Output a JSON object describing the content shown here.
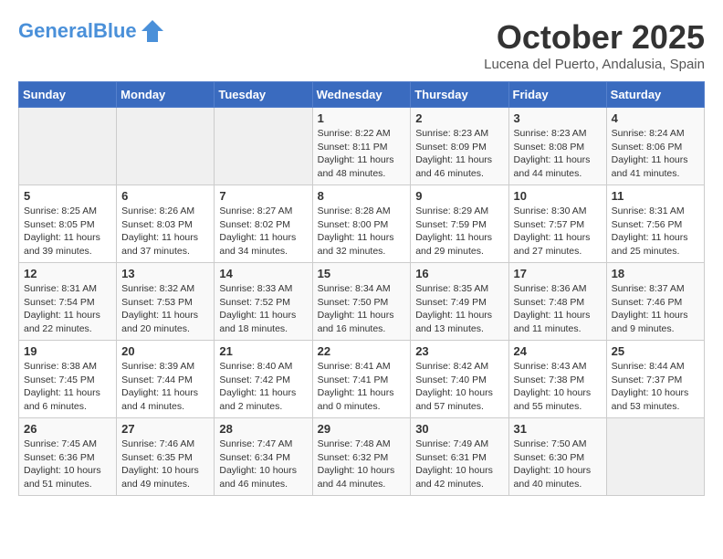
{
  "header": {
    "logo_line1": "General",
    "logo_line2": "Blue",
    "month": "October 2025",
    "location": "Lucena del Puerto, Andalusia, Spain"
  },
  "weekdays": [
    "Sunday",
    "Monday",
    "Tuesday",
    "Wednesday",
    "Thursday",
    "Friday",
    "Saturday"
  ],
  "weeks": [
    [
      {
        "day": "",
        "info": ""
      },
      {
        "day": "",
        "info": ""
      },
      {
        "day": "",
        "info": ""
      },
      {
        "day": "1",
        "info": "Sunrise: 8:22 AM\nSunset: 8:11 PM\nDaylight: 11 hours and 48 minutes."
      },
      {
        "day": "2",
        "info": "Sunrise: 8:23 AM\nSunset: 8:09 PM\nDaylight: 11 hours and 46 minutes."
      },
      {
        "day": "3",
        "info": "Sunrise: 8:23 AM\nSunset: 8:08 PM\nDaylight: 11 hours and 44 minutes."
      },
      {
        "day": "4",
        "info": "Sunrise: 8:24 AM\nSunset: 8:06 PM\nDaylight: 11 hours and 41 minutes."
      }
    ],
    [
      {
        "day": "5",
        "info": "Sunrise: 8:25 AM\nSunset: 8:05 PM\nDaylight: 11 hours and 39 minutes."
      },
      {
        "day": "6",
        "info": "Sunrise: 8:26 AM\nSunset: 8:03 PM\nDaylight: 11 hours and 37 minutes."
      },
      {
        "day": "7",
        "info": "Sunrise: 8:27 AM\nSunset: 8:02 PM\nDaylight: 11 hours and 34 minutes."
      },
      {
        "day": "8",
        "info": "Sunrise: 8:28 AM\nSunset: 8:00 PM\nDaylight: 11 hours and 32 minutes."
      },
      {
        "day": "9",
        "info": "Sunrise: 8:29 AM\nSunset: 7:59 PM\nDaylight: 11 hours and 29 minutes."
      },
      {
        "day": "10",
        "info": "Sunrise: 8:30 AM\nSunset: 7:57 PM\nDaylight: 11 hours and 27 minutes."
      },
      {
        "day": "11",
        "info": "Sunrise: 8:31 AM\nSunset: 7:56 PM\nDaylight: 11 hours and 25 minutes."
      }
    ],
    [
      {
        "day": "12",
        "info": "Sunrise: 8:31 AM\nSunset: 7:54 PM\nDaylight: 11 hours and 22 minutes."
      },
      {
        "day": "13",
        "info": "Sunrise: 8:32 AM\nSunset: 7:53 PM\nDaylight: 11 hours and 20 minutes."
      },
      {
        "day": "14",
        "info": "Sunrise: 8:33 AM\nSunset: 7:52 PM\nDaylight: 11 hours and 18 minutes."
      },
      {
        "day": "15",
        "info": "Sunrise: 8:34 AM\nSunset: 7:50 PM\nDaylight: 11 hours and 16 minutes."
      },
      {
        "day": "16",
        "info": "Sunrise: 8:35 AM\nSunset: 7:49 PM\nDaylight: 11 hours and 13 minutes."
      },
      {
        "day": "17",
        "info": "Sunrise: 8:36 AM\nSunset: 7:48 PM\nDaylight: 11 hours and 11 minutes."
      },
      {
        "day": "18",
        "info": "Sunrise: 8:37 AM\nSunset: 7:46 PM\nDaylight: 11 hours and 9 minutes."
      }
    ],
    [
      {
        "day": "19",
        "info": "Sunrise: 8:38 AM\nSunset: 7:45 PM\nDaylight: 11 hours and 6 minutes."
      },
      {
        "day": "20",
        "info": "Sunrise: 8:39 AM\nSunset: 7:44 PM\nDaylight: 11 hours and 4 minutes."
      },
      {
        "day": "21",
        "info": "Sunrise: 8:40 AM\nSunset: 7:42 PM\nDaylight: 11 hours and 2 minutes."
      },
      {
        "day": "22",
        "info": "Sunrise: 8:41 AM\nSunset: 7:41 PM\nDaylight: 11 hours and 0 minutes."
      },
      {
        "day": "23",
        "info": "Sunrise: 8:42 AM\nSunset: 7:40 PM\nDaylight: 10 hours and 57 minutes."
      },
      {
        "day": "24",
        "info": "Sunrise: 8:43 AM\nSunset: 7:38 PM\nDaylight: 10 hours and 55 minutes."
      },
      {
        "day": "25",
        "info": "Sunrise: 8:44 AM\nSunset: 7:37 PM\nDaylight: 10 hours and 53 minutes."
      }
    ],
    [
      {
        "day": "26",
        "info": "Sunrise: 7:45 AM\nSunset: 6:36 PM\nDaylight: 10 hours and 51 minutes."
      },
      {
        "day": "27",
        "info": "Sunrise: 7:46 AM\nSunset: 6:35 PM\nDaylight: 10 hours and 49 minutes."
      },
      {
        "day": "28",
        "info": "Sunrise: 7:47 AM\nSunset: 6:34 PM\nDaylight: 10 hours and 46 minutes."
      },
      {
        "day": "29",
        "info": "Sunrise: 7:48 AM\nSunset: 6:32 PM\nDaylight: 10 hours and 44 minutes."
      },
      {
        "day": "30",
        "info": "Sunrise: 7:49 AM\nSunset: 6:31 PM\nDaylight: 10 hours and 42 minutes."
      },
      {
        "day": "31",
        "info": "Sunrise: 7:50 AM\nSunset: 6:30 PM\nDaylight: 10 hours and 40 minutes."
      },
      {
        "day": "",
        "info": ""
      }
    ]
  ]
}
